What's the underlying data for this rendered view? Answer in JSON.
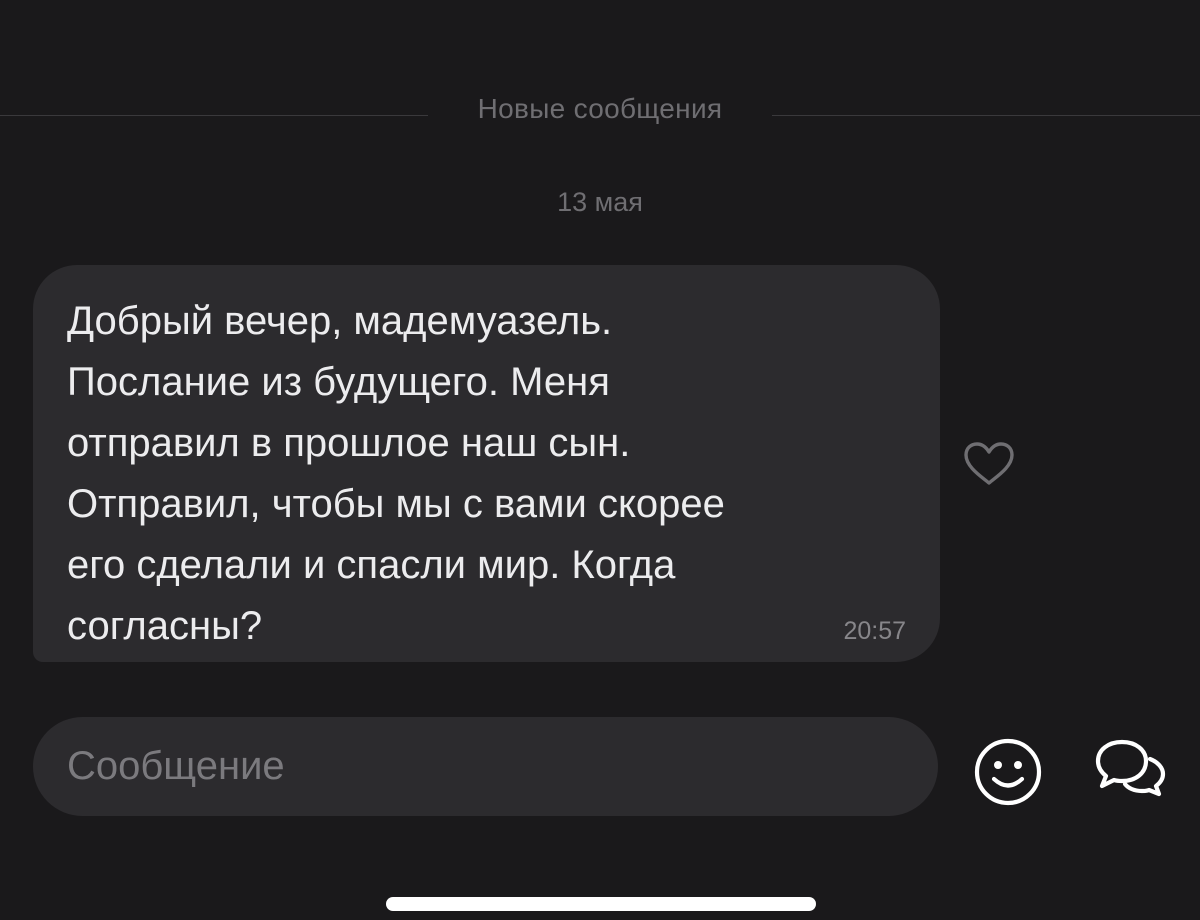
{
  "chat": {
    "new_messages_label": "Новые сообщения",
    "date_label": "13 мая",
    "message": {
      "text": "Добрый вечер, мадемуазель.\nПослание из будущего. Меня\nотправил в прошлое наш сын.\nОтправил, чтобы мы с вами скорее\nего сделали и спасли мир. Когда\nсогласны?",
      "time": "20:57",
      "like_icon": "heart-outline-icon"
    }
  },
  "composer": {
    "placeholder": "Сообщение",
    "value": "",
    "emoji_icon": "smiley-icon",
    "chat_icon": "chat-bubbles-icon"
  },
  "colors": {
    "background": "#1a191b",
    "bubble": "#2c2b2e",
    "primary_text": "#ececee",
    "secondary_text": "#6f6e72"
  }
}
